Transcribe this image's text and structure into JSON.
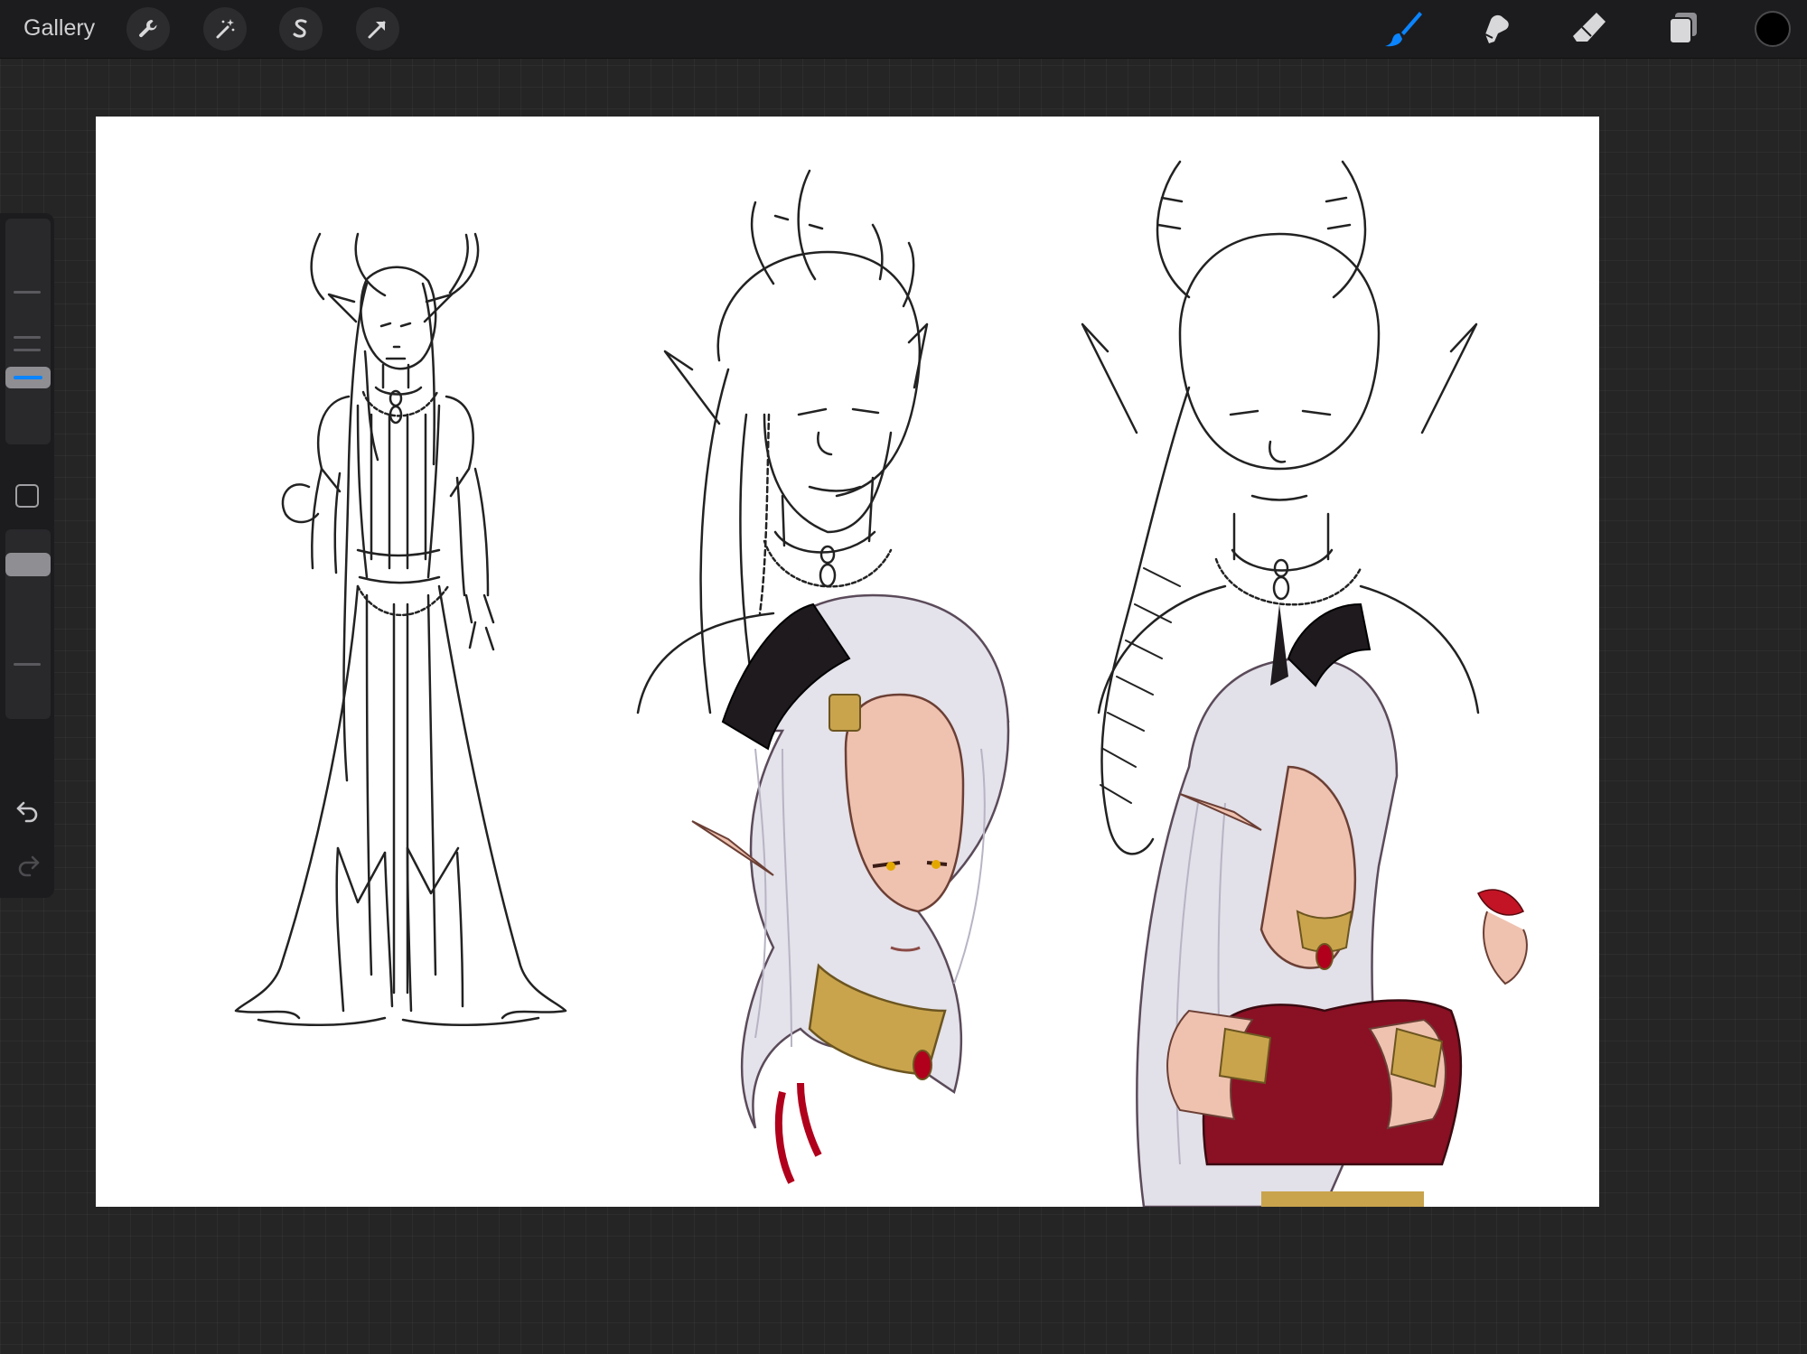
{
  "topbar": {
    "gallery_label": "Gallery",
    "left_tools": [
      "wrench-icon",
      "magic-wand-icon",
      "selection-icon",
      "transform-arrow-icon"
    ],
    "right_tools": [
      "brush-icon",
      "smudge-icon",
      "eraser-icon",
      "layers-icon"
    ],
    "active_tool": "brush-icon",
    "accent_color": "#0a84ff",
    "current_color": "#000000"
  },
  "sidebar": {
    "brush_size_level": 0.25,
    "opacity_level": 1.0,
    "buttons": [
      "modify-square-icon",
      "undo-icon",
      "redo-icon"
    ]
  },
  "canvas": {
    "background": "#ffffff",
    "artwork": [
      "full-body-lineart",
      "head-lineart-left",
      "head-lineart-right",
      "colored-portrait-left",
      "colored-portrait-right"
    ]
  }
}
